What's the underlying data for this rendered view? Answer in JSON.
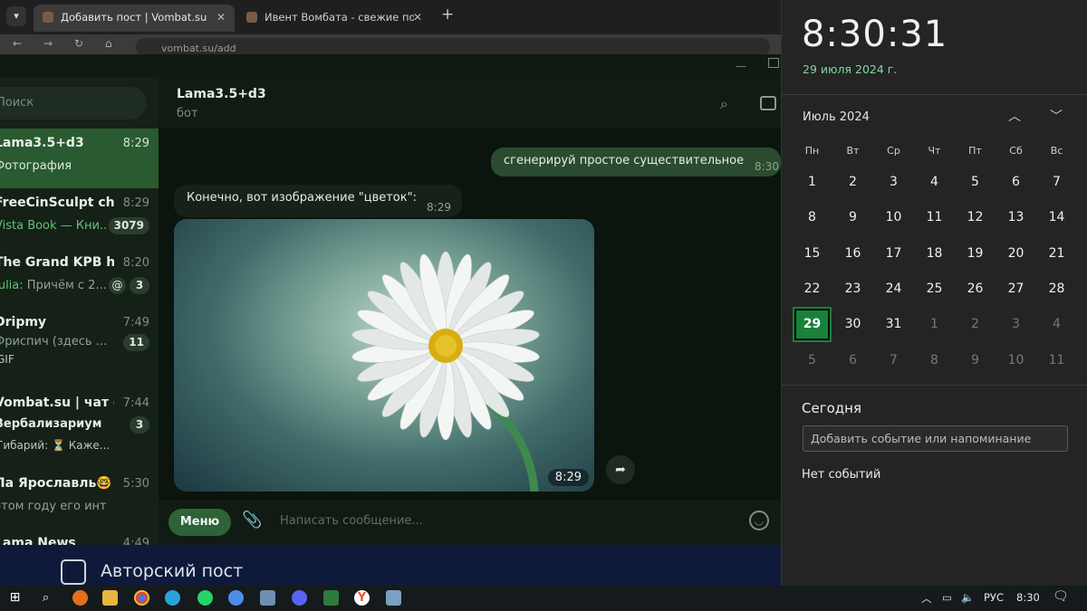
{
  "browser": {
    "tabs": [
      {
        "title": "Добавить пост | Vombat.su",
        "active": true
      },
      {
        "title": "Ивент Вомбата - свежие пост",
        "active": false
      }
    ],
    "url": "vombat.su/add"
  },
  "telegram": {
    "search_placeholder": "Поиск",
    "chats": [
      {
        "name": "Lama3.5+d3",
        "time": "8:29",
        "preview": "Фотография",
        "active": true
      },
      {
        "name": "FreeCinSculpt chat",
        "time": "8:29",
        "preview_sender": "Vista Book — Кни...",
        "preview": "",
        "badge": "3079"
      },
      {
        "name": "The Grand KPB hotel",
        "time": "8:20",
        "preview_sender": "Julia:",
        "preview": "Причём с 2...",
        "mention": "@",
        "badge": "3"
      },
      {
        "name": "Dripmy",
        "time": "7:49",
        "preview": "Фриспич (здесь ...",
        "badge": "11",
        "extra": "GIF"
      },
      {
        "name": "Vombat.su | чат с...",
        "time": "7:44",
        "preview": "Вербализариум",
        "badge": "3",
        "extra": "Гибарий: ⏳ Каже..."
      },
      {
        "name": "Ла Ярославль🤓",
        "time": "5:30",
        "preview": "этом году его интервь..."
      },
      {
        "name": "Lama News",
        "time": "4:49",
        "preview": ""
      }
    ],
    "header": {
      "name": "Lama3.5+d3",
      "status": "бот"
    },
    "messages": {
      "out": {
        "text": "сгенерируй простое существительное",
        "time": "8:30"
      },
      "in": {
        "text": "Конечно, вот изображение \"цветок\":",
        "time": "8:29"
      },
      "photo_time": "8:29"
    },
    "composer": {
      "menu_label": "Меню",
      "placeholder": "Написать сообщение..."
    }
  },
  "post": {
    "checkbox_label": "Авторский пост"
  },
  "calendar": {
    "time": "8:30:31",
    "date": "29 июля 2024 г.",
    "month": "Июль 2024",
    "weekdays": [
      "Пн",
      "Вт",
      "Ср",
      "Чт",
      "Пт",
      "Сб",
      "Вс"
    ],
    "weeks": [
      [
        "1",
        "2",
        "3",
        "4",
        "5",
        "6",
        "7"
      ],
      [
        "8",
        "9",
        "10",
        "11",
        "12",
        "13",
        "14"
      ],
      [
        "15",
        "16",
        "17",
        "18",
        "19",
        "20",
        "21"
      ],
      [
        "22",
        "23",
        "24",
        "25",
        "26",
        "27",
        "28"
      ],
      [
        "29",
        "30",
        "31",
        "1",
        "2",
        "3",
        "4"
      ],
      [
        "5",
        "6",
        "7",
        "8",
        "9",
        "10",
        "11"
      ]
    ],
    "today_label": "Сегодня",
    "event_placeholder": "Добавить событие или напоминание",
    "no_events": "Нет событий"
  },
  "taskbar": {
    "lang": "РУС",
    "clock": "8:30"
  },
  "colors": {
    "tg_active": "#2a5a30",
    "cal_today": "#18823b",
    "date_green": "#7ed7a0"
  }
}
